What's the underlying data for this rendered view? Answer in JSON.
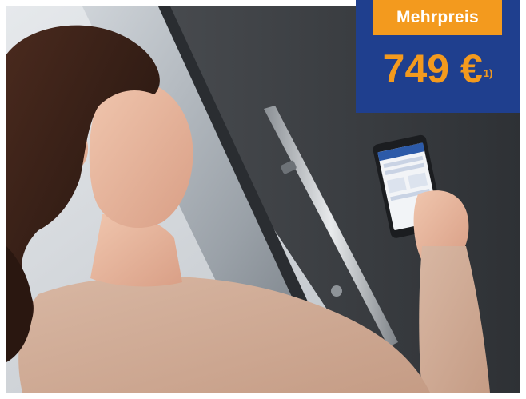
{
  "offer": {
    "label": "Mehrpreis",
    "price": "749 €",
    "footnote": "1)"
  },
  "colors": {
    "label_background": "#f39a1e",
    "price_background": "#1f3f8e",
    "price_text": "#f39a1e"
  }
}
